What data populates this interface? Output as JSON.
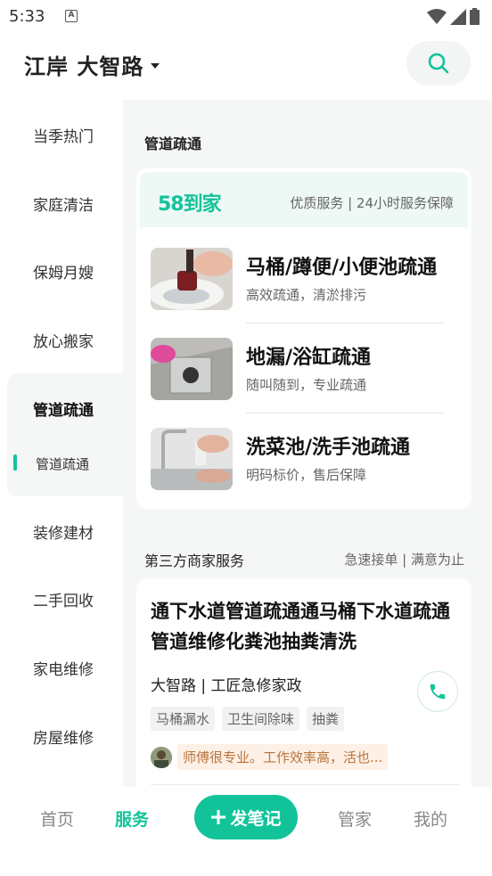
{
  "status_bar": {
    "time": "5:33",
    "notification_glyph": "A"
  },
  "header": {
    "location": "江岸 大智路"
  },
  "sidebar": {
    "items": [
      {
        "label": "当季热门"
      },
      {
        "label": "家庭清洁"
      },
      {
        "label": "保姆月嫂"
      },
      {
        "label": "放心搬家"
      },
      {
        "label": "管道疏通"
      },
      {
        "label": "装修建材"
      },
      {
        "label": "二手回收"
      },
      {
        "label": "家电维修"
      },
      {
        "label": "房屋维修"
      }
    ],
    "active_sub": "管道疏通"
  },
  "main": {
    "section_title": "管道疏通",
    "card": {
      "brand": "58到家",
      "brand_tagline": "优质服务 | 24小时服务保障",
      "services": [
        {
          "title": "马桶/蹲便/小便池疏通",
          "subtitle": "高效疏通，清淤排污"
        },
        {
          "title": "地漏/浴缸疏通",
          "subtitle": "随叫随到，专业疏通"
        },
        {
          "title": "洗菜池/洗手池疏通",
          "subtitle": "明码标价，售后保障"
        }
      ]
    },
    "third_party": {
      "title": "第三方商家服务",
      "tagline": "急速接单 | 满意为止",
      "listing": {
        "title": "通下水道管道疏通通马桶下水道疏通管道维修化粪池抽粪清洗",
        "shop": "大智路 | 工匠急修家政",
        "tags": [
          "马桶漏水",
          "卫生间除味",
          "抽粪"
        ],
        "review": "师傅很专业。工作效率高，活也..."
      }
    }
  },
  "bottom_nav": {
    "home": "首页",
    "service": "服务",
    "post": "发笔记",
    "manager": "管家",
    "mine": "我的"
  },
  "colors": {
    "accent": "#12c39a",
    "review_text": "#b8743a",
    "review_bg": "#fdf0e6"
  }
}
